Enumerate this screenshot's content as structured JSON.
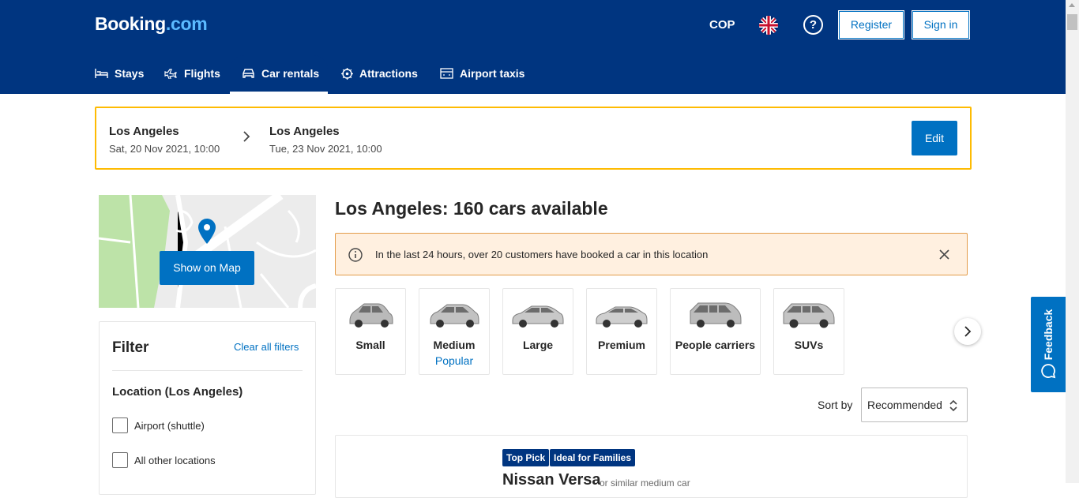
{
  "header": {
    "logo_main": "Booking",
    "logo_tld": ".com",
    "currency": "COP",
    "help": "?",
    "register": "Register",
    "signin": "Sign in",
    "nav": [
      {
        "label": "Stays",
        "icon": "bed-icon"
      },
      {
        "label": "Flights",
        "icon": "plane-icon"
      },
      {
        "label": "Car rentals",
        "icon": "car-icon",
        "active": true
      },
      {
        "label": "Attractions",
        "icon": "attractions-icon"
      },
      {
        "label": "Airport taxis",
        "icon": "taxi-icon"
      }
    ]
  },
  "search": {
    "pickup_location": "Los Angeles",
    "pickup_date": "Sat, 20 Nov 2021, 10:00",
    "dropoff_location": "Los Angeles",
    "dropoff_date": "Tue, 23 Nov 2021, 10:00",
    "edit": "Edit"
  },
  "map": {
    "button": "Show on Map"
  },
  "filter": {
    "title": "Filter",
    "clear": "Clear all filters",
    "location_heading": "Location (Los Angeles)",
    "options": [
      "Airport (shuttle)",
      "All other locations"
    ]
  },
  "results": {
    "title": "Los Angeles: 160 cars available",
    "notice": "In the last 24 hours, over 20 customers have booked a car in this location",
    "categories": [
      {
        "name": "Small",
        "tag": ""
      },
      {
        "name": "Medium",
        "tag": "Popular"
      },
      {
        "name": "Large",
        "tag": ""
      },
      {
        "name": "Premium",
        "tag": ""
      },
      {
        "name": "People carriers",
        "tag": ""
      },
      {
        "name": "SUVs",
        "tag": ""
      }
    ],
    "sort_label": "Sort by",
    "sort_value": "Recommended",
    "first_result": {
      "badges": [
        "Top Pick",
        "Ideal for Families"
      ],
      "name": "Nissan Versa",
      "similar": "or similar medium car"
    }
  },
  "feedback": "Feedback",
  "colors": {
    "brand_dark": "#003580",
    "brand_blue": "#0071c2",
    "search_border": "#febb02",
    "notice_bg": "#fff0e0"
  }
}
